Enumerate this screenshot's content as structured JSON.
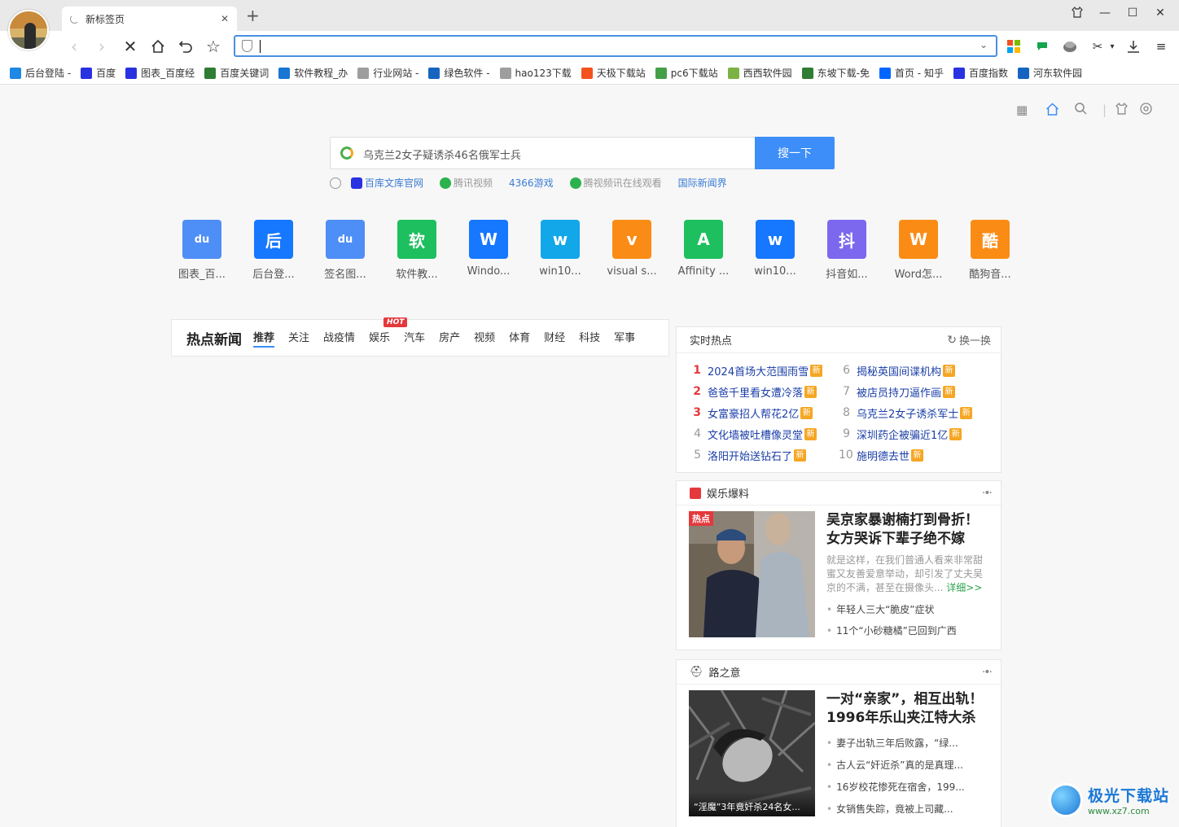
{
  "tab": {
    "title": "新标签页"
  },
  "bookmarks": [
    {
      "label": "后台登陆 -",
      "icon": "swirl-icon",
      "color": "#1e88e5"
    },
    {
      "label": "百度",
      "icon": "baidu-paw-icon",
      "color": "#2932e1"
    },
    {
      "label": "图表_百度经",
      "icon": "baidu-paw-icon",
      "color": "#2932e1"
    },
    {
      "label": "百度关键词",
      "icon": "page-icon",
      "color": "#2e7d32"
    },
    {
      "label": "软件教程_办",
      "icon": "eye-icon",
      "color": "#1976d2"
    },
    {
      "label": "行业网站 -",
      "icon": "doc-icon",
      "color": "#9e9e9e"
    },
    {
      "label": "绿色软件 -",
      "icon": "y-icon",
      "color": "#1565c0"
    },
    {
      "label": "hao123下载",
      "icon": "doc-icon",
      "color": "#9e9e9e"
    },
    {
      "label": "天极下载站",
      "icon": "e-icon",
      "color": "#f4511e"
    },
    {
      "label": "pc6下载站",
      "icon": "pc6-icon",
      "color": "#43a047"
    },
    {
      "label": "西西软件园",
      "icon": "cc-icon",
      "color": "#7cb342"
    },
    {
      "label": "东坡下载-免",
      "icon": "d-icon",
      "color": "#2e7d32"
    },
    {
      "label": "首页 - 知乎",
      "icon": "zhihu-icon",
      "color": "#0066ff"
    },
    {
      "label": "百度指数",
      "icon": "baidu-paw-icon",
      "color": "#2932e1"
    },
    {
      "label": "河东软件园",
      "icon": "globe-icon",
      "color": "#1565c0"
    }
  ],
  "search": {
    "query": "乌克兰2女子疑诱杀46名俄军士兵",
    "button": "搜一下"
  },
  "hot_links": [
    {
      "label": "百库文库官网",
      "style": "blue"
    },
    {
      "label": "腾讯视频",
      "style": "grey"
    },
    {
      "label": "4366游戏",
      "style": "blue"
    },
    {
      "label": "腾视频讯在线观看",
      "style": "grey"
    },
    {
      "label": "国际新闻界",
      "style": "blue"
    }
  ],
  "speed_dial": [
    {
      "label": "图表_百...",
      "glyph": "du",
      "color": "#4e8ef7"
    },
    {
      "label": "后台登...",
      "glyph": "后",
      "color": "#1677ff"
    },
    {
      "label": "签名图...",
      "glyph": "du",
      "color": "#4e8ef7"
    },
    {
      "label": "软件教...",
      "glyph": "软",
      "color": "#1dbf5e"
    },
    {
      "label": "Windo...",
      "glyph": "W",
      "color": "#1677ff"
    },
    {
      "label": "win10...",
      "glyph": "w",
      "color": "#11a7e8"
    },
    {
      "label": "visual s...",
      "glyph": "v",
      "color": "#fa8c16"
    },
    {
      "label": "Affinity ...",
      "glyph": "A",
      "color": "#1dbf5e"
    },
    {
      "label": "win10...",
      "glyph": "w",
      "color": "#1677ff"
    },
    {
      "label": "抖音如...",
      "glyph": "抖",
      "color": "#7b68ee"
    },
    {
      "label": "Word怎...",
      "glyph": "W",
      "color": "#fa8c16"
    },
    {
      "label": "酷狗音...",
      "glyph": "酷",
      "color": "#fa8c16"
    }
  ],
  "news": {
    "title": "热点新闻",
    "hot_badge": "HOT",
    "tabs": [
      "推荐",
      "关注",
      "战疫情",
      "娱乐",
      "汽车",
      "房产",
      "视频",
      "体育",
      "财经",
      "科技",
      "军事"
    ]
  },
  "realtime": {
    "title": "实时热点",
    "refresh": "换一换",
    "new_tag": "新",
    "items": [
      {
        "rank": "1",
        "text": "2024首场大范围雨雪"
      },
      {
        "rank": "6",
        "text": "揭秘英国间谍机构"
      },
      {
        "rank": "2",
        "text": "爸爸千里看女遭冷落"
      },
      {
        "rank": "7",
        "text": "被店员持刀逼作画"
      },
      {
        "rank": "3",
        "text": "女富豪招人帮花2亿"
      },
      {
        "rank": "8",
        "text": "乌克兰2女子诱杀军士"
      },
      {
        "rank": "4",
        "text": "文化墙被吐槽像灵堂"
      },
      {
        "rank": "9",
        "text": "深圳药企被骗近1亿"
      },
      {
        "rank": "5",
        "text": "洛阳开始送钻石了"
      },
      {
        "rank": "10",
        "text": "施明德去世"
      }
    ]
  },
  "ent": {
    "title": "娱乐爆料",
    "hot_tag": "热点",
    "headline": "吴京家暴谢楠打到骨折！女方哭诉下辈子绝不嫁给...",
    "desc": "就是这样，在我们普通人看来非常甜蜜又友善爱意举动，却引发了丈夫吴京的不满，甚至在摄像头...",
    "detail": "详细>>",
    "bullets": [
      "年轻人三大“脆皮”症状",
      "11个“小砂糖橘”已回到广西"
    ]
  },
  "lu": {
    "title": "路之意",
    "headline": "一对“亲家”，相互出轨！1996年乐山夹江特大杀人...",
    "caption": "“淫魔”3年竟奸杀24名女...",
    "bullets": [
      "妻子出轨三年后败露，“绿...",
      "古人云“奸近杀”真的是真理...",
      "16岁校花惨死在宿舍，199...",
      "女销售失踪，竟被上司藏..."
    ]
  },
  "watermark": {
    "cn": "极光下载站",
    "url": "www.xz7.com"
  }
}
